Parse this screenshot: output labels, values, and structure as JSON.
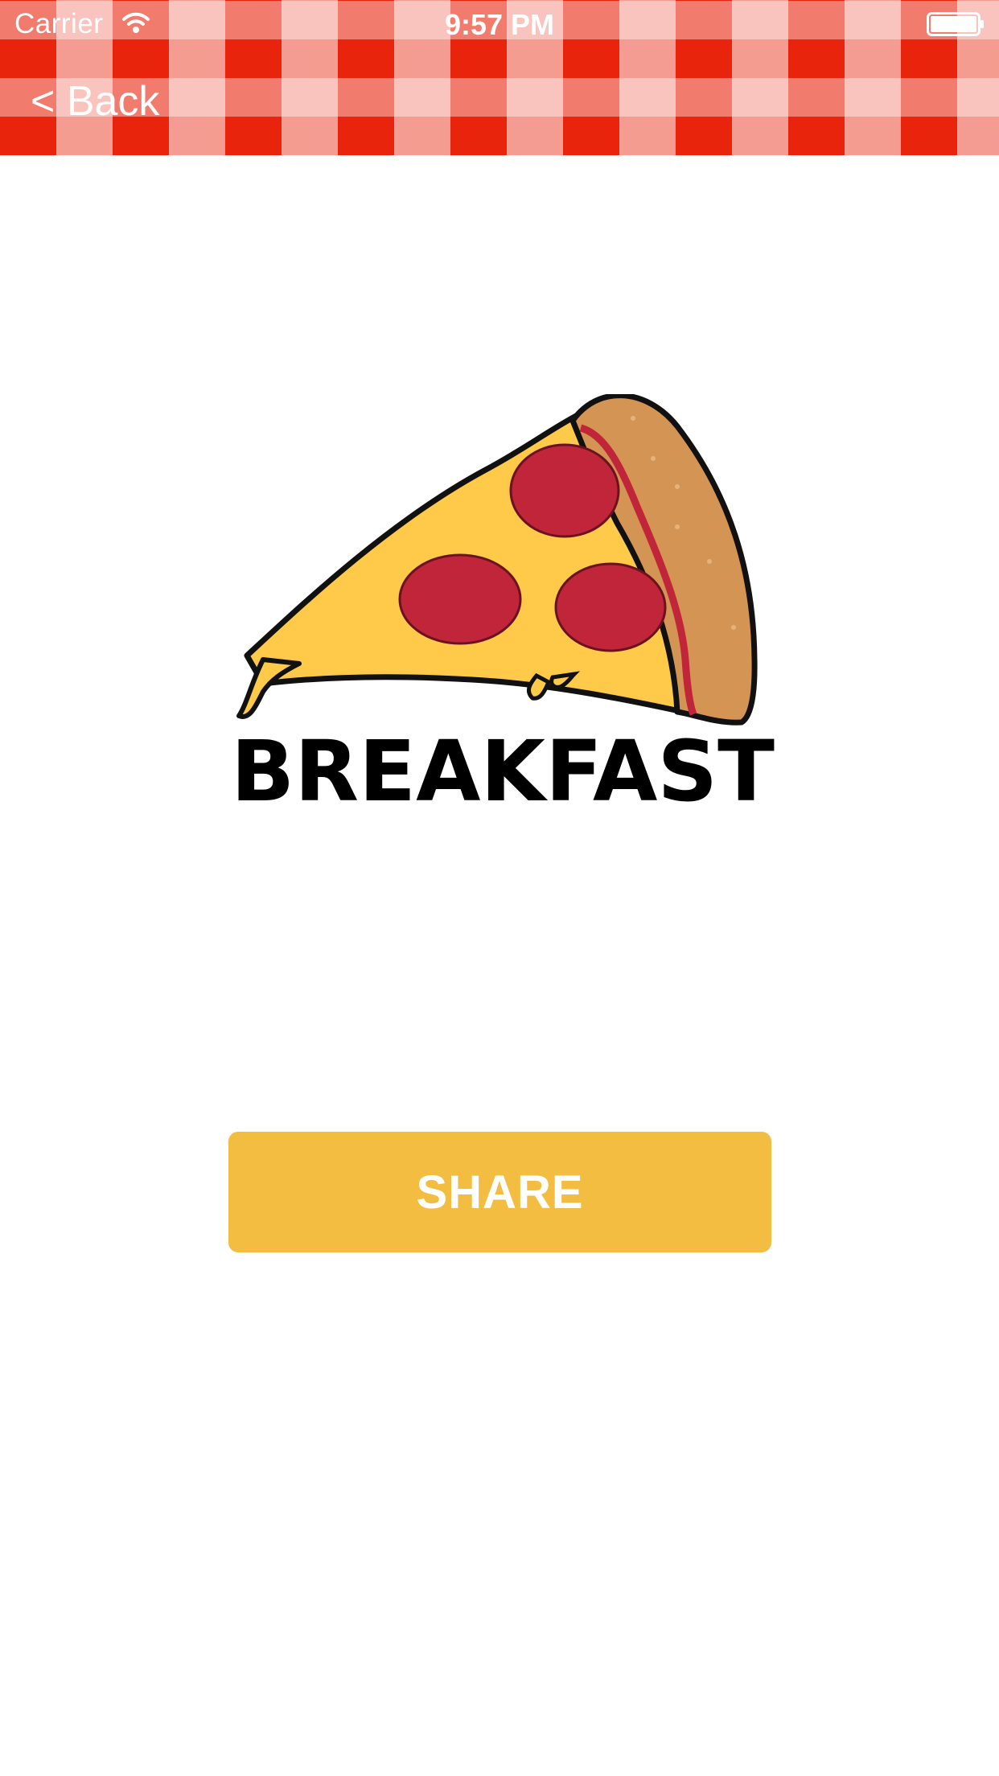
{
  "status_bar": {
    "carrier": "Carrier",
    "time": "9:57 PM",
    "wifi_icon": "wifi-icon",
    "battery_icon": "battery-icon"
  },
  "nav": {
    "back_label": "< Back",
    "background_color": "#e8240c"
  },
  "logo": {
    "icon": "pizza-slice-icon",
    "text": "BREAKFAST"
  },
  "share_button": {
    "label": "SHARE",
    "color": "#f3bd42"
  }
}
